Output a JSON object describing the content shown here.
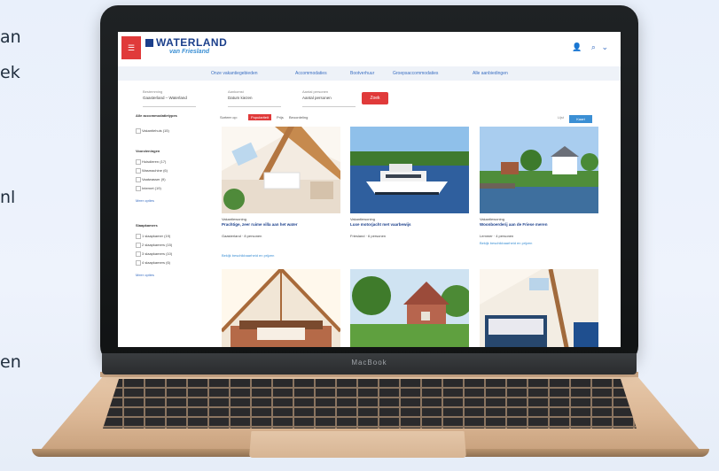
{
  "side_text": [
    "an",
    "ek",
    "nl",
    "en"
  ],
  "laptop": {
    "brand": "MacBook"
  },
  "app": {
    "logo": "WATERLAND",
    "logo_sub": "van Friesland",
    "menu_icon_label": "menu",
    "top_icons": [
      "user-icon",
      "search-icon",
      "chevron-down-icon"
    ]
  },
  "nav": {
    "items": [
      "Onze vakantiegebieden",
      "Accommodaties",
      "Bootverhuur",
      "Groepsaccommodaties",
      "Alle aanbiedingen"
    ]
  },
  "search": {
    "fields": [
      {
        "label": "Bestemming",
        "value": "Gaasterland – Waterland"
      },
      {
        "label": "Aankomst",
        "value": "Datum kiezen"
      },
      {
        "label": "Aantal personen",
        "value": "Aantal personen"
      }
    ],
    "button": "Zoek"
  },
  "filters": {
    "groups": [
      {
        "title": "Alle accommodatietypes",
        "options": [
          "Vakantiehuis (15)"
        ],
        "more": ""
      },
      {
        "title": "Voorzieningen",
        "options": [
          "Huisdieren (17)",
          "Wasmachine (6)",
          "Vaatwasser (9)",
          "Internet (19)"
        ],
        "more": "Meer opties"
      },
      {
        "title": "Slaapkamers",
        "options": [
          "1 slaapkamer (19)",
          "2 slaapkamers (15)",
          "3 slaapkamers (10)",
          "4 slaapkamers (6)"
        ],
        "more": "Meer opties"
      }
    ]
  },
  "sortbar": {
    "label": "Sorteer op:",
    "options": [
      "Populariteit",
      "Prijs",
      "Beoordeling"
    ],
    "active": "Populariteit",
    "list_label": "Lijst",
    "map_button": "Kaart"
  },
  "cards": [
    {
      "type": "Vakantiewoning",
      "title": "Prachtige, zeer ruime villa aan het water",
      "desc": "Gaasterland · 8 personen",
      "link": "Bekijk beschikbaarheid en prijzen"
    },
    {
      "type": "Vakantiewoning",
      "title": "Luxe motorjacht met vaarbewijs",
      "desc": "Friesland · 6 personen",
      "link": ""
    },
    {
      "type": "Vakantiewoning",
      "title": "Woonboerderij aan de Friese meren",
      "desc": "Lemmer · 4 personen",
      "link": "Bekijk beschikbaarheid en prijzen"
    },
    {
      "type": "",
      "title": "",
      "desc": "",
      "link": ""
    },
    {
      "type": "",
      "title": "",
      "desc": "",
      "link": ""
    },
    {
      "type": "",
      "title": "",
      "desc": "",
      "link": ""
    }
  ],
  "colors": {
    "accent": "#e03a3a",
    "brand": "#1b3f8b",
    "link": "#3b8fd4"
  }
}
